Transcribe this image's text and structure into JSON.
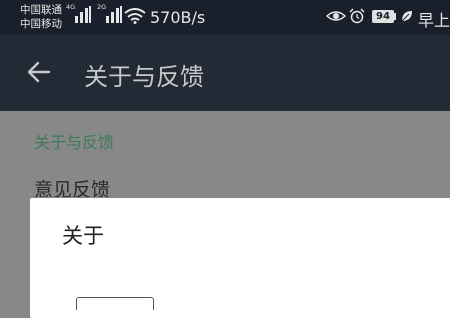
{
  "status_bar": {
    "carrier_1": "中国联通",
    "carrier_2": "中国移动",
    "network_1": "4G",
    "network_2": "2G",
    "speed": "570B/s",
    "battery": "94",
    "time_partial": "早上"
  },
  "app_bar": {
    "title": "关于与反馈"
  },
  "settings": {
    "section_title": "关于与反馈",
    "item_label": "意见反馈"
  },
  "dialog": {
    "title": "关于"
  },
  "colors": {
    "accent": "#3d7a5c",
    "appbar": "#222a36",
    "statusbar": "#1a202b"
  }
}
